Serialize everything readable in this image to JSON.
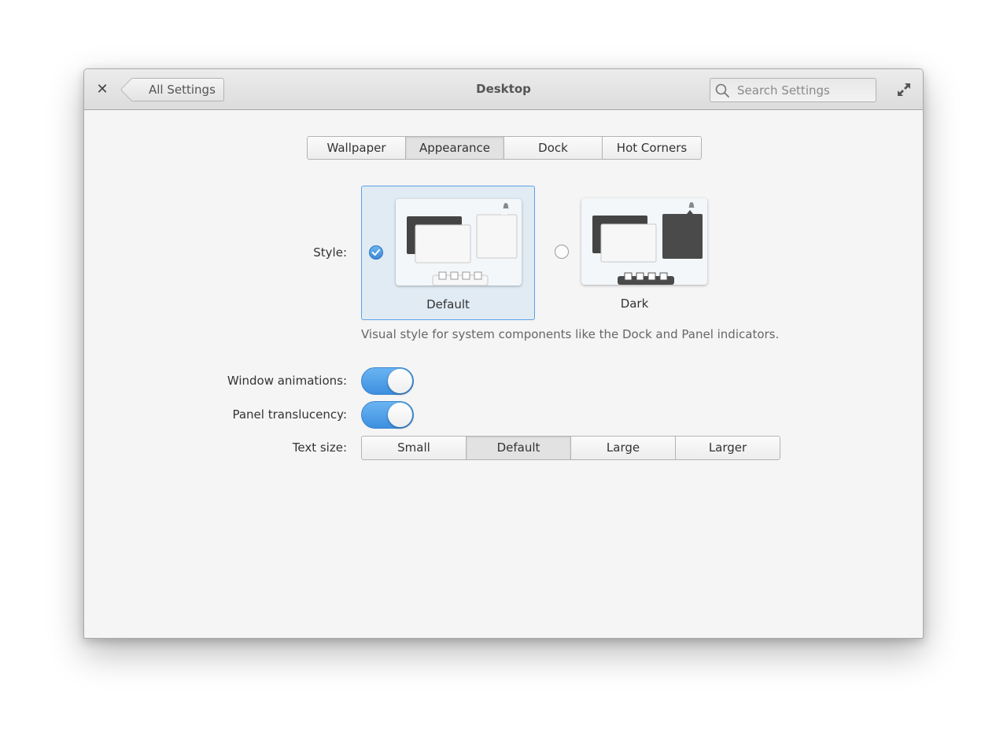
{
  "window": {
    "title": "Desktop"
  },
  "header": {
    "back_label": "All Settings",
    "search_placeholder": "Search Settings"
  },
  "tabs": [
    {
      "label": "Wallpaper",
      "active": false
    },
    {
      "label": "Appearance",
      "active": true
    },
    {
      "label": "Dock",
      "active": false
    },
    {
      "label": "Hot Corners",
      "active": false
    }
  ],
  "style": {
    "label": "Style:",
    "options": [
      {
        "label": "Default",
        "selected": true
      },
      {
        "label": "Dark",
        "selected": false
      }
    ],
    "description": "Visual style for system components like the Dock and Panel indicators."
  },
  "window_animations": {
    "label": "Window animations:",
    "enabled": true
  },
  "panel_translucency": {
    "label": "Panel translucency:",
    "enabled": true
  },
  "text_size": {
    "label": "Text size:",
    "options": [
      "Small",
      "Default",
      "Large",
      "Larger"
    ],
    "selected": "Default"
  },
  "colors": {
    "accent": "#3d8fe0",
    "selection_bg": "#e0ebf4",
    "dark_window": "#4a4a4a"
  },
  "icons": [
    "close-icon",
    "back-arrow-icon",
    "search-icon",
    "maximize-icon",
    "checkmark-icon",
    "bell-icon"
  ]
}
